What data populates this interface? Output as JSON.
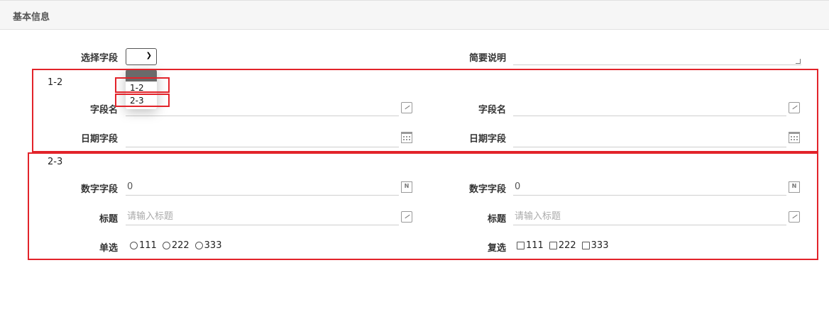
{
  "header": {
    "title": "基本信息"
  },
  "top": {
    "select_label": "选择字段",
    "select_value": "",
    "desc_label": "简要说明",
    "dropdown_options": [
      "1-2",
      "2-3"
    ]
  },
  "group1": {
    "title": "1-2",
    "left": {
      "name_label": "字段名",
      "date_label": "日期字段"
    },
    "right": {
      "name_label": "字段名",
      "date_label": "日期字段"
    }
  },
  "group2": {
    "title": "2-3",
    "left": {
      "num_label": "数字字段",
      "num_value": "0",
      "title_label": "标题",
      "title_placeholder": "请输入标题",
      "radio_label": "单选",
      "radio_options": [
        "111",
        "222",
        "333"
      ]
    },
    "right": {
      "num_label": "数字字段",
      "num_value": "0",
      "title_label": "标题",
      "title_placeholder": "请输入标题",
      "check_label": "复选",
      "check_options": [
        "111",
        "222",
        "333"
      ]
    }
  },
  "colors": {
    "highlight": "#e2232a",
    "border": "#cfcfcf"
  }
}
